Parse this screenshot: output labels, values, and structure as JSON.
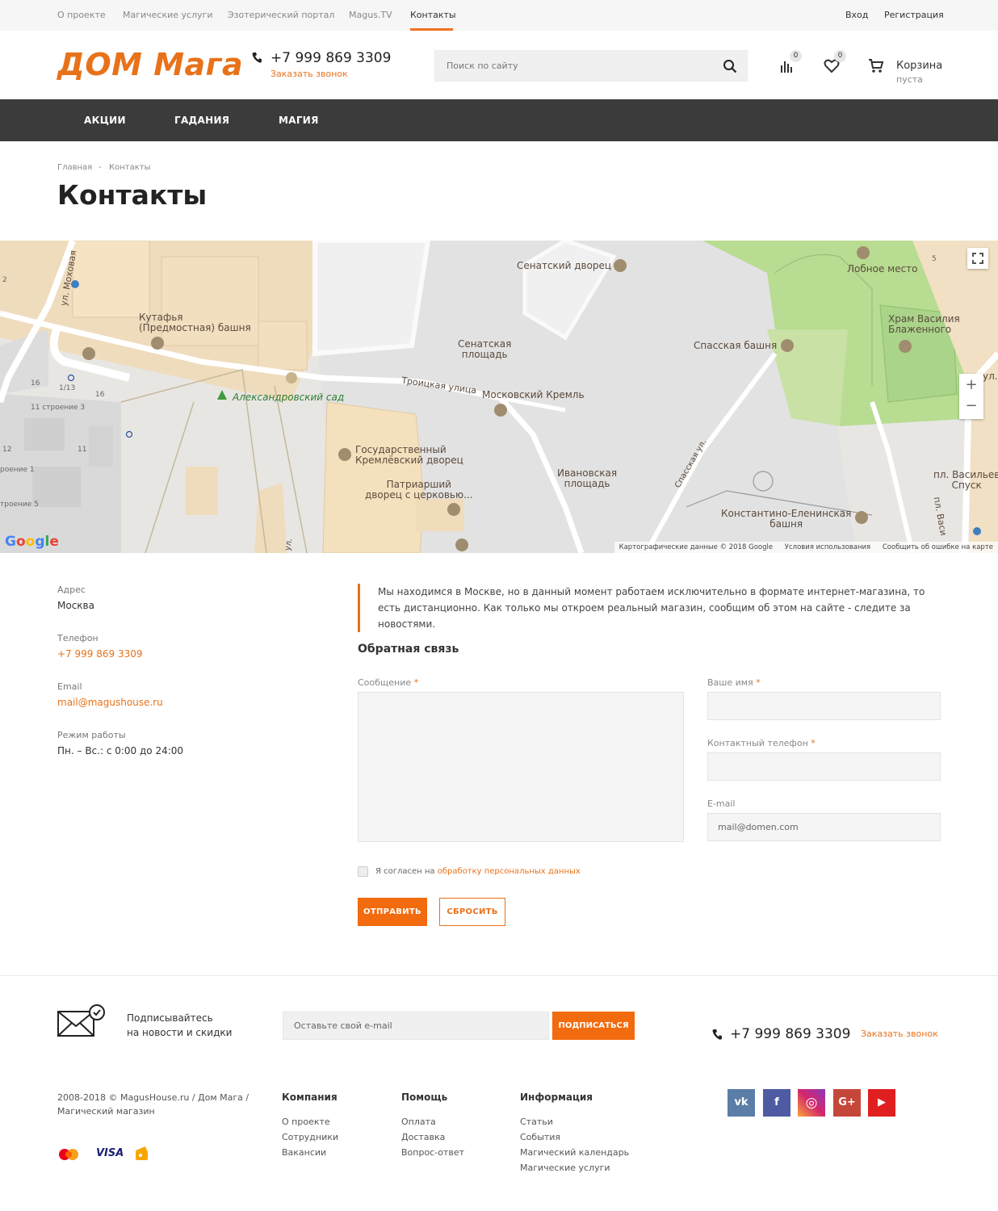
{
  "topbar": {
    "links": [
      "О проекте",
      "Магические услуги",
      "Эзотерический портал",
      "Magus.TV",
      "Контакты"
    ],
    "login": "Вход",
    "register": "Регистрация"
  },
  "header": {
    "logo": "ДОМ Мага",
    "phone": "+7 999 869 3309",
    "callback": "Заказать звонок",
    "search_placeholder": "Поиск по сайту",
    "compare_count": "0",
    "favorites_count": "0",
    "cart_title": "Корзина",
    "cart_status": "пуста"
  },
  "nav": {
    "items": [
      "АКЦИИ",
      "ГАДАНИЯ",
      "МАГИЯ"
    ]
  },
  "breadcrumb": {
    "home": "Главная",
    "separator": "-",
    "current": "Контакты"
  },
  "page_title": "Контакты",
  "map": {
    "labels": {
      "senate_palace": "Сенатский дворец",
      "lobnoe": "Лобное место",
      "kutafya": "Кутафья\n(Предмостная) башня",
      "vasily": "Храм Василия\nБлаженного",
      "senate_sq": "Сенатская\nплощадь",
      "spasskaya": "Спасская башня",
      "troitskaya": "Троицкая улица",
      "kremlin": "Московский Кремль",
      "garden": "Александровский сад",
      "palace": "Государственный\nКремлёвский дворец",
      "ivanovskaya": "Ивановская\nплощадь",
      "patriarch": "Патриарший\nдворец с церковью...",
      "spasskaya_st": "Спасская ул.",
      "konstantino": "Константино-Еленинская\nбашня",
      "mokhovaya": "ул. Моховая",
      "vasilevsky": "пл. Васильев\nСпуск",
      "ul": "ул.",
      "ul2": "ул.",
      "pl_vas": "пл. Васи",
      "s3": "11 строение 3",
      "s5": "троение 5",
      "s1": "роение 1",
      "n16": "16",
      "n113": "1/13",
      "n16b": "16",
      "n11": "11",
      "n12": "12",
      "n5": "5",
      "n2": "2"
    },
    "google": "Google",
    "footer": [
      "Картографические данные © 2018 Google",
      "Условия использования",
      "Сообщить об ошибке на карте"
    ],
    "zoom_in": "+",
    "zoom_out": "−"
  },
  "contacts": {
    "address_label": "Адрес",
    "address": "Москва",
    "phone_label": "Телефон",
    "phone": "+7 999 869 3309",
    "email_label": "Email",
    "email": "mail@magushouse.ru",
    "hours_label": "Режим работы",
    "hours": "Пн. – Вс.: с 0:00 до 24:00"
  },
  "notice": "Мы находимся в Москве, но в данный момент работаем исключительно в формате интернет-магазина, то есть дистанционно. Как только мы откроем реальный магазин, сообщим об этом на сайте - следите за новостями.",
  "form": {
    "title": "Обратная связь",
    "message_label": "Сообщение",
    "name_label": "Ваше имя",
    "phone_label": "Контактный телефон",
    "email_label": "E-mail",
    "email_placeholder": "mail@domen.com",
    "required_mark": "*",
    "agree_prefix": "Я согласен на ",
    "agree_link": "обработку персональных данных",
    "submit": "ОТПРАВИТЬ",
    "reset": "СБРОСИТЬ"
  },
  "footer": {
    "subscribe_line1": "Подписывайтесь",
    "subscribe_line2": "на новости и скидки",
    "subscribe_placeholder": "Оставьте свой e-mail",
    "subscribe_btn": "ПОДПИСАТЬСЯ",
    "phone": "+7 999 869 3309",
    "callback": "Заказать звонок",
    "copyright_line1": "2008-2018 © MagusHouse.ru / Дом Мага /",
    "copyright_line2": "Магический магазин",
    "payments": [
      "MasterCard",
      "VISA",
      "Яндекс.Деньги"
    ],
    "visa": "VISA",
    "columns": [
      {
        "title": "Компания",
        "items": [
          "О проекте",
          "Сотрудники",
          "Вакансии"
        ]
      },
      {
        "title": "Помощь",
        "items": [
          "Оплата",
          "Доставка",
          "Вопрос-ответ"
        ]
      },
      {
        "title": "Информация",
        "items": [
          "Статьи",
          "События",
          "Магический календарь",
          "Магические услуги"
        ]
      }
    ],
    "social": [
      {
        "name": "vk",
        "label": "vk",
        "color": "#5b7ea8"
      },
      {
        "name": "facebook",
        "label": "f",
        "color": "#4e5ba3"
      },
      {
        "name": "instagram",
        "label": "◎",
        "color": "#c1358a"
      },
      {
        "name": "google-plus",
        "label": "G+",
        "color": "#c5473a"
      },
      {
        "name": "youtube",
        "label": "▶",
        "color": "#e02020"
      }
    ]
  },
  "colors": {
    "accent": "#f26b0f",
    "nav_bg": "#3b3b3b"
  }
}
